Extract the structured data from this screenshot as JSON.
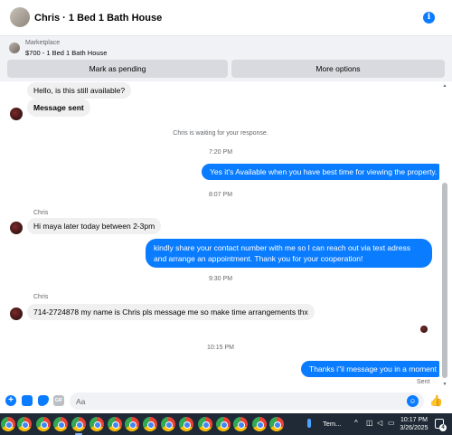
{
  "header": {
    "title": "Chris · 1 Bed 1 Bath House",
    "info_icon": "i"
  },
  "marketplace": {
    "kicker": "Marketplace",
    "listing": "$700 - 1 Bed 1 Bath House",
    "mark_pending_label": "Mark as pending",
    "more_options_label": "More options"
  },
  "messages": {
    "m1": "Hello, is this still available?",
    "m2": "Message sent",
    "system_note": "Chris is waiting for your response.",
    "ts1": "7:20 PM",
    "m3": "Yes it's Available when you have best time for viewing the property.",
    "ts2": "8:07 PM",
    "sender1": "Chris",
    "m4": "Hi maya later today between 2-3pm",
    "m5": "kindly share your contact number with me so I can reach out via text adress and arrange an appointment. Thank you for your cooperation!",
    "ts3": "9:30 PM",
    "sender2": "Chris",
    "m6": "714-2724878 my name is Chris pls message me so make time arrangements thx",
    "ts4": "10:15 PM",
    "m7": "Thanks i\"il message you in a moment",
    "sent_label": "Sent"
  },
  "composer": {
    "placeholder": "Aa",
    "gif_label": "GIF"
  },
  "taskbar": {
    "weather_label": "Tem...",
    "time": "10:17 PM",
    "date": "3/26/2025",
    "notification_count": "4"
  },
  "colors": {
    "accent": "#0a7cff",
    "taskbar": "#1f2a36"
  }
}
